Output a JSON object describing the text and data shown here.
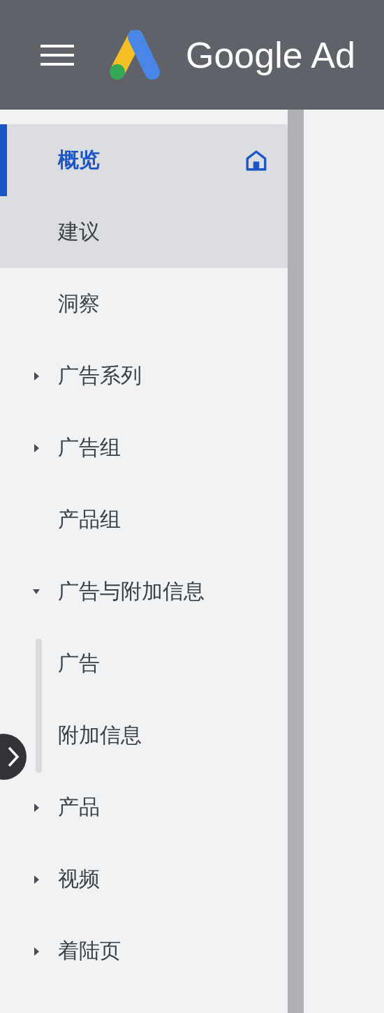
{
  "header": {
    "title": "Google Ad"
  },
  "nav": {
    "items": [
      {
        "kind": "link",
        "label": "概览",
        "selected": true,
        "highlighted": true,
        "home": true
      },
      {
        "kind": "link",
        "label": "建议",
        "selected": false,
        "highlighted": true
      },
      {
        "kind": "link",
        "label": "洞察",
        "selected": false,
        "highlighted": false
      },
      {
        "kind": "group",
        "label": "广告系列",
        "selected": false,
        "highlighted": false,
        "expanded": false
      },
      {
        "kind": "group",
        "label": "广告组",
        "selected": false,
        "highlighted": false,
        "expanded": false
      },
      {
        "kind": "link",
        "label": "产品组",
        "selected": false,
        "highlighted": false
      },
      {
        "kind": "group",
        "label": "广告与附加信息",
        "selected": false,
        "highlighted": false,
        "expanded": true,
        "children": [
          {
            "label": "广告",
            "selected": false
          },
          {
            "label": "附加信息",
            "selected": false
          }
        ]
      },
      {
        "kind": "group",
        "label": "产品",
        "selected": false,
        "highlighted": false,
        "expanded": false
      },
      {
        "kind": "group",
        "label": "视频",
        "selected": false,
        "highlighted": false,
        "expanded": false
      },
      {
        "kind": "group",
        "label": "着陆页",
        "selected": false,
        "highlighted": false,
        "expanded": false
      }
    ]
  }
}
